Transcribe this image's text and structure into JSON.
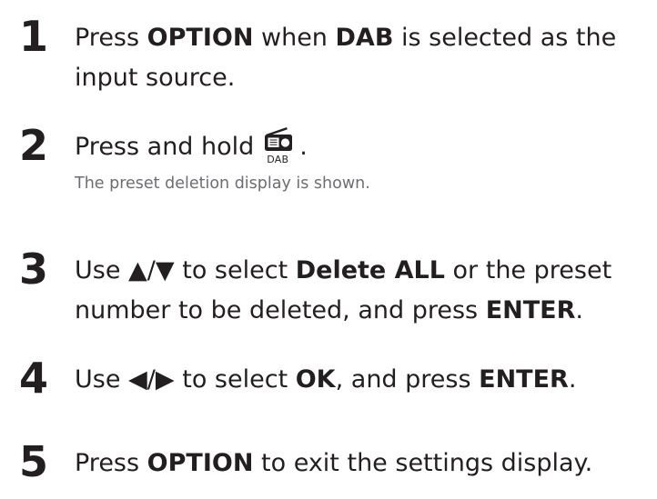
{
  "steps": [
    {
      "number": "1",
      "line1": {
        "t1": "Press ",
        "b1": "OPTION",
        "t2": " when ",
        "b2": "DAB",
        "t3": " is selected as the"
      },
      "line2": "input source."
    },
    {
      "number": "2",
      "text": "Press and hold",
      "icon_label": "DAB",
      "icon_name": "radio-icon",
      "after_icon": ".",
      "note": "The preset deletion display is shown."
    },
    {
      "number": "3",
      "line1": {
        "t1": "Use ",
        "symbols": "▲/▼",
        "t2": " to select ",
        "b1": "Delete ALL",
        "t3": " or the preset"
      },
      "line2": {
        "t1": "number to be deleted, and press ",
        "b1": "ENTER",
        "t2": "."
      }
    },
    {
      "number": "4",
      "line1": {
        "t1": "Use ",
        "symbols": "◀/▶",
        "t2": " to select ",
        "b1": "OK",
        "t3": ", and press ",
        "b2": "ENTER",
        "t4": "."
      }
    },
    {
      "number": "5",
      "line1": {
        "t1": "Press ",
        "b1": "OPTION",
        "t2": " to exit the settings display."
      }
    }
  ]
}
